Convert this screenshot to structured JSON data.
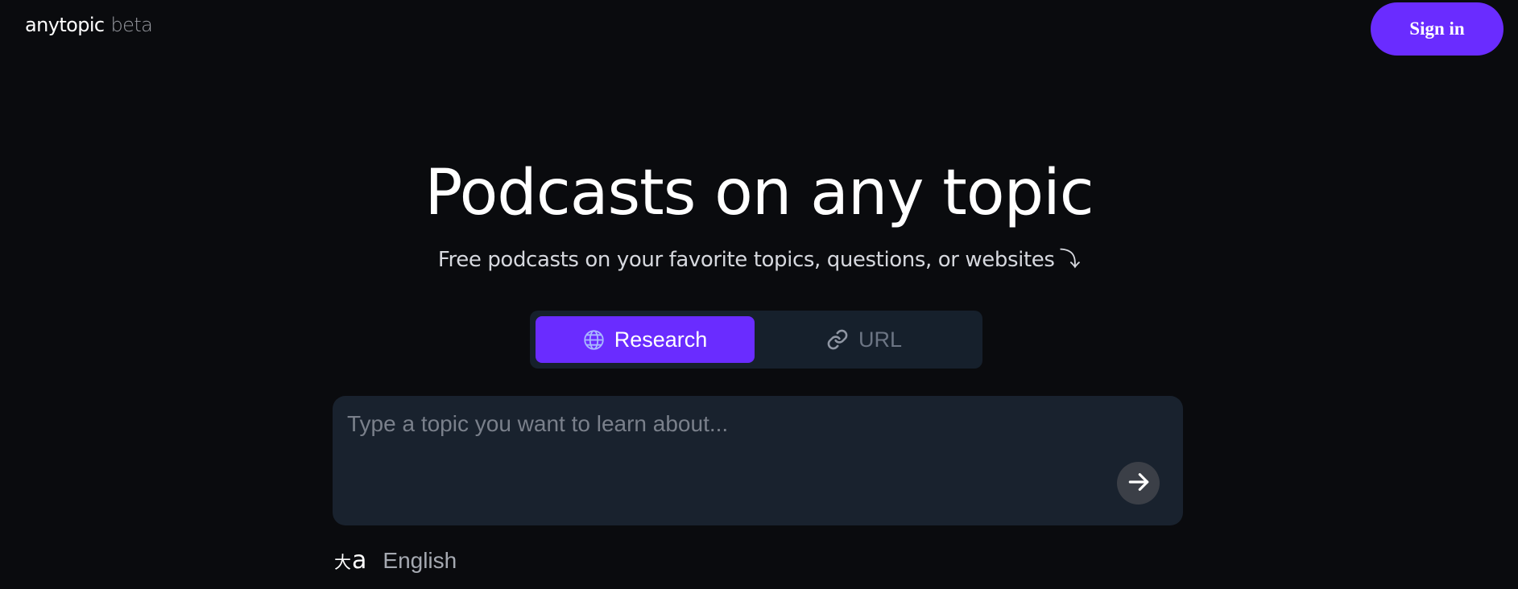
{
  "header": {
    "brand": "anytopic",
    "brand_tag": "beta",
    "signin_label": "Sign in"
  },
  "hero": {
    "title": "Podcasts on any topic",
    "subtitle": "Free podcasts on your favorite topics, questions, or websites",
    "subtitle_arrow": "⤵"
  },
  "modes": {
    "selected": "Research",
    "items": [
      {
        "label": "Research",
        "icon": "globe-icon"
      },
      {
        "label": "URL",
        "icon": "link-icon"
      }
    ]
  },
  "topic_input": {
    "placeholder": "Type a topic you want to learn about...",
    "value": "",
    "submit_icon": "arrow-right-icon"
  },
  "language": {
    "icon": "translate-icon",
    "icon_glyph_cjk": "大",
    "icon_glyph_latin": "a",
    "label": "English"
  },
  "colors": {
    "background": "#0a0b0e",
    "accent": "#6a2cff",
    "panel": "#19222e",
    "switch_bg": "#16202c"
  }
}
